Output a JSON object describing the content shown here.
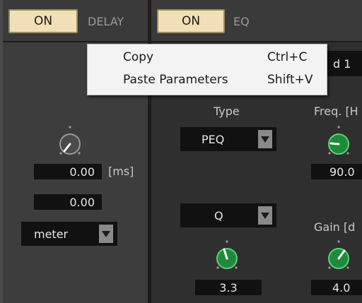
{
  "delay_section": {
    "on_label": "ON",
    "title": "DELAY",
    "delay_value": "0.00",
    "delay_unit": "[ms]",
    "sub_value": "0.00",
    "meter_select": "meter"
  },
  "eq_section": {
    "on_label": "ON",
    "title": "EQ",
    "band_field": "d 1",
    "type_label": "Type",
    "type_select": "PEQ",
    "freq_label": "Freq. [H",
    "freq_value": "90.0",
    "q_select": "Q",
    "q_value": "3.3",
    "gain_label": "Gain [d",
    "gain_value": "4.0"
  },
  "context_menu": {
    "items": [
      {
        "label": "Copy",
        "shortcut": "Ctrl+C"
      },
      {
        "label": "Paste Parameters",
        "shortcut": "Shift+V"
      }
    ]
  },
  "colors": {
    "on_button": "#f1dfb7",
    "knob_green": "#1f8a3a",
    "knob_gray": "#444444",
    "menu_bg": "#f3f3f3"
  }
}
